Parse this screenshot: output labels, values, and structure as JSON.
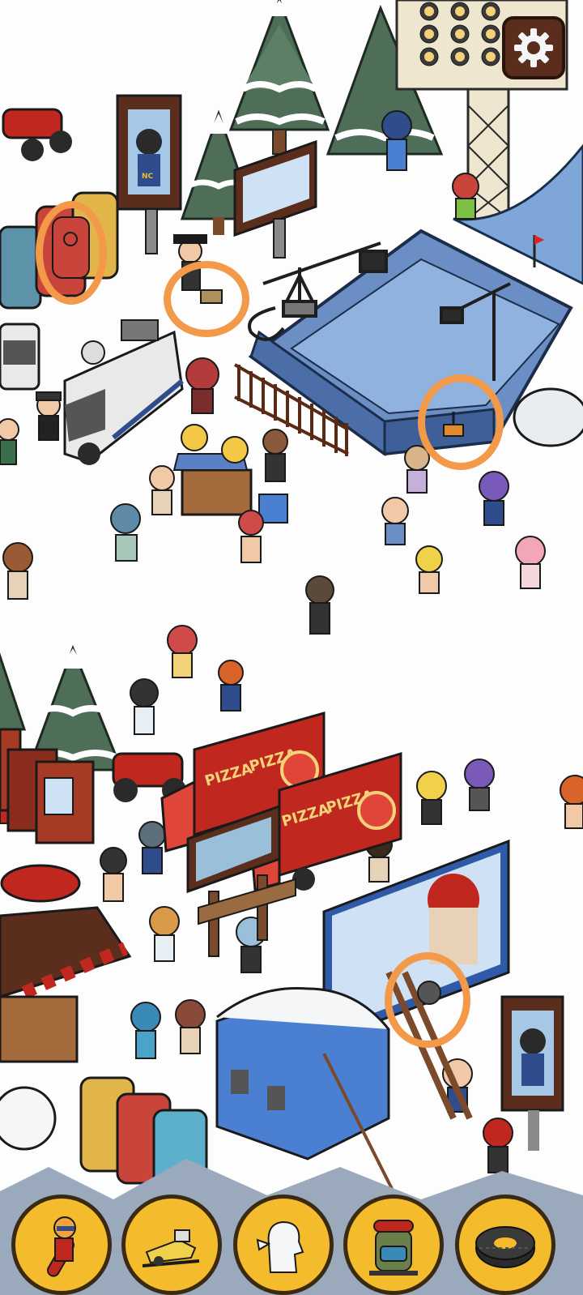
{
  "scene": {
    "truck_labels": [
      "PIZZA",
      "PIZZA",
      "PIZZA",
      "PIZZA"
    ],
    "poster_badge": "NC",
    "found_markers": [
      "found-door",
      "found-box",
      "found-shovel",
      "found-cable-wheel"
    ]
  },
  "settings": {
    "icon": "gear-icon"
  },
  "item_tray": {
    "items": [
      {
        "id": "snowboarder",
        "icon": "snowboarder-icon",
        "found": false
      },
      {
        "id": "snowmobile",
        "icon": "snowmobile-icon",
        "found": false
      },
      {
        "id": "snow-creature",
        "icon": "snow-creature-icon",
        "found": false
      },
      {
        "id": "backpack",
        "icon": "backpack-icon",
        "found": false
      },
      {
        "id": "tire",
        "icon": "tire-icon",
        "found": false
      }
    ]
  },
  "colors": {
    "highlight": "#f39a4a",
    "tray_button": "#f4bc2d",
    "settings_bg": "#5a2d1c",
    "ramp": "#6b8fc4",
    "truck": "#c0281f",
    "tree": "#4e6e58"
  }
}
